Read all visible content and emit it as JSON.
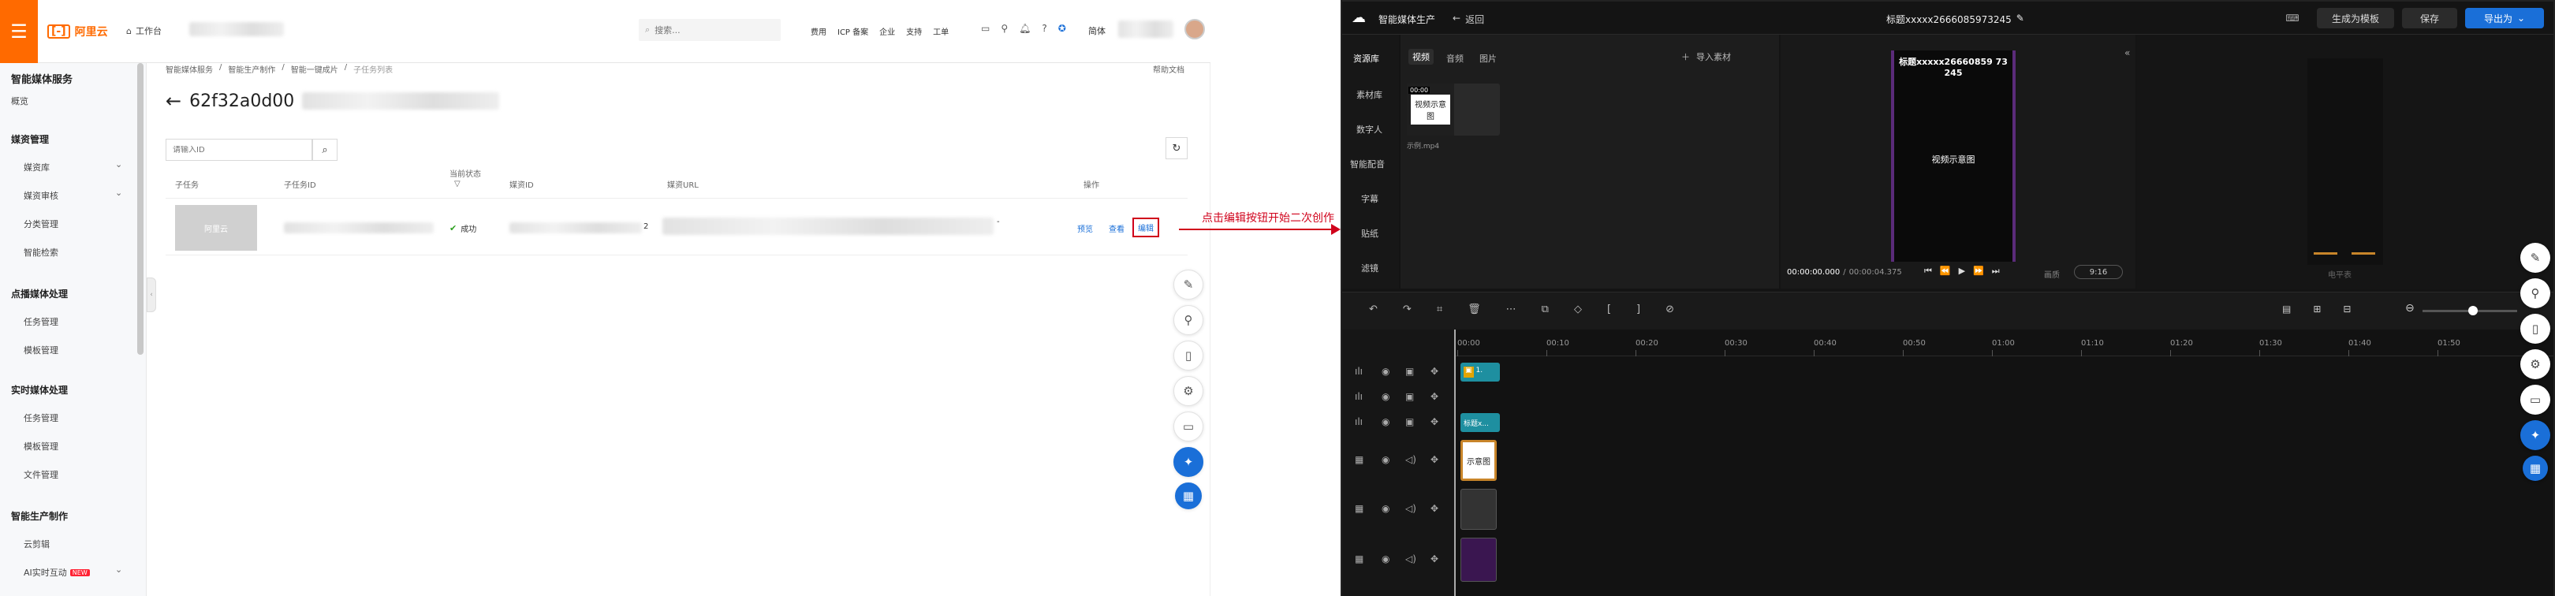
{
  "console": {
    "brand": "阿里云",
    "workbench": "工作台",
    "search_placeholder": "搜索...",
    "nav": [
      "费用",
      "ICP 备案",
      "企业",
      "支持",
      "工单"
    ],
    "lang": "简体",
    "sidebar": {
      "title": "智能媒体服务",
      "overview": "概览",
      "groups": [
        {
          "title": "媒资管理",
          "items": [
            {
              "label": "媒资库",
              "chev": true
            },
            {
              "label": "媒资审核",
              "chev": true
            },
            {
              "label": "分类管理"
            },
            {
              "label": "智能检索"
            }
          ]
        },
        {
          "title": "点播媒体处理",
          "items": [
            {
              "label": "任务管理"
            },
            {
              "label": "模板管理"
            }
          ]
        },
        {
          "title": "实时媒体处理",
          "items": [
            {
              "label": "任务管理"
            },
            {
              "label": "模板管理"
            },
            {
              "label": "文件管理"
            }
          ]
        },
        {
          "title": "智能生产制作",
          "items": [
            {
              "label": "云剪辑"
            },
            {
              "label": "AI实时互动",
              "badge": "NEW",
              "chev": true
            }
          ]
        }
      ]
    },
    "breadcrumb": [
      "智能媒体服务",
      "智能生产制作",
      "智能一键成片",
      "子任务列表"
    ],
    "help": "帮助文档",
    "page_title_prefix": "62f32a0d00",
    "filter_placeholder": "请输入ID",
    "table": {
      "headers": [
        "子任务",
        "子任务ID",
        "当前状态",
        "媒资ID",
        "媒资URL",
        "操作"
      ],
      "row": {
        "thumb_text": "阿里云",
        "status": "成功",
        "media_suffix": "2",
        "url_suffix": "-",
        "actions": [
          "预览",
          "查看",
          "编辑"
        ]
      }
    },
    "annotation": "点击编辑按钮开始二次创作"
  },
  "editor": {
    "app_title": "智能媒体生产",
    "back": "返回",
    "project_name": "标题xxxxx2666085973245",
    "buttons": {
      "template": "生成为模板",
      "save": "保存",
      "export": "导出为"
    },
    "left_nav": [
      "资源库",
      "素材库",
      "数字人",
      "智能配音",
      "字幕",
      "贴纸",
      "滤镜"
    ],
    "tabs": [
      "视频",
      "音频",
      "图片"
    ],
    "import": "导入素材",
    "clip": {
      "duration": "00:00",
      "thumb_text": "视频示意图",
      "name": "示例.mp4"
    },
    "preview": {
      "caption": "标题xxxxx26660859 73245",
      "center_text": "视频示意图",
      "time_current": "00:00:00.000",
      "time_total": "00:00:04.375",
      "quality": "画质",
      "ratio": "9:16"
    },
    "right_label": "电平表",
    "ruler": [
      "00:00",
      "00:10",
      "00:20",
      "00:30",
      "00:40",
      "00:50",
      "01:00",
      "01:10",
      "01:20",
      "01:30",
      "01:40",
      "01:50"
    ],
    "tracks": {
      "clip1": "1.",
      "clip2": "标题x...",
      "clip3": "示意图"
    }
  }
}
